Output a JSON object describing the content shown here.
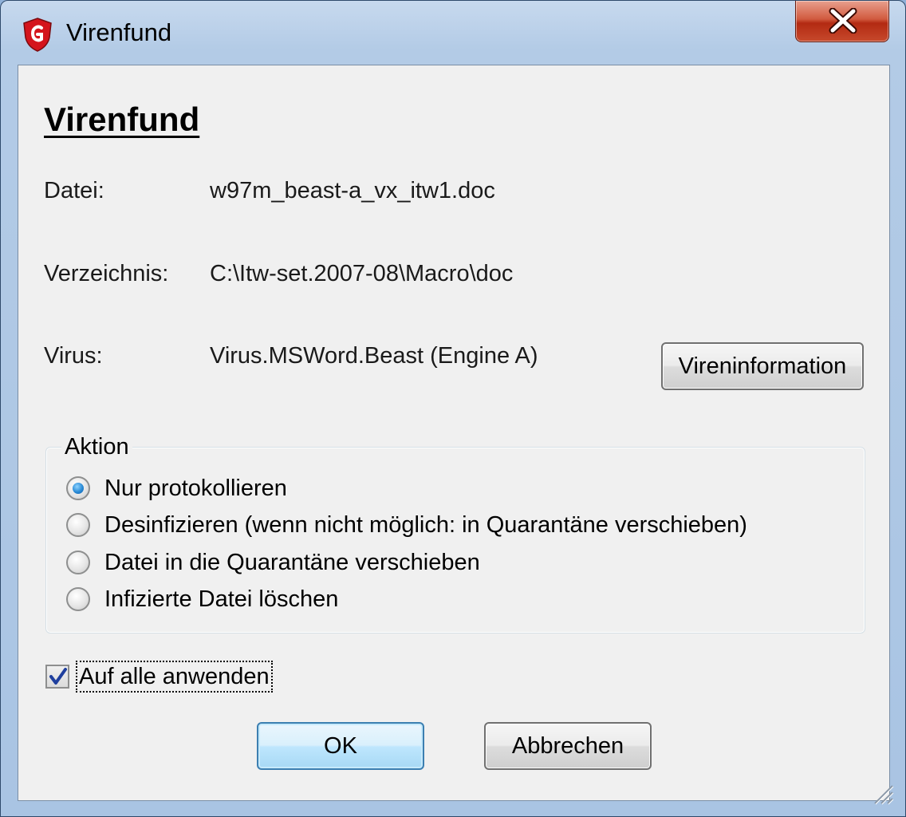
{
  "window": {
    "title": "Virenfund",
    "close_label": "X"
  },
  "content": {
    "heading": "Virenfund",
    "file": {
      "label": "Datei:",
      "value": "w97m_beast-a_vx_itw1.doc"
    },
    "directory": {
      "label": "Verzeichnis:",
      "value": "C:\\Itw-set.2007-08\\Macro\\doc"
    },
    "virus": {
      "label": "Virus:",
      "value": "Virus.MSWord.Beast (Engine A)"
    },
    "virus_info_button": "Vireninformation"
  },
  "action": {
    "legend": "Aktion",
    "options": [
      {
        "label": "Nur protokollieren",
        "checked": true
      },
      {
        "label": "Desinfizieren (wenn nicht möglich: in Quarantäne verschieben)",
        "checked": false
      },
      {
        "label": "Datei in die Quarantäne verschieben",
        "checked": false
      },
      {
        "label": "Infizierte Datei löschen",
        "checked": false
      }
    ]
  },
  "apply_all": {
    "label": "Auf alle anwenden",
    "checked": true
  },
  "buttons": {
    "ok": "OK",
    "cancel": "Abbrechen"
  },
  "colors": {
    "title_bar": "#b3cbe6",
    "dialog_bg": "#f0f0f0",
    "close_button": "#c7492c",
    "default_button_border": "#3c7fb1",
    "shield_red": "#d4141c"
  },
  "icons": {
    "app": "shield-icon",
    "close": "close-icon",
    "check": "check-icon",
    "grip": "resize-grip-icon"
  }
}
